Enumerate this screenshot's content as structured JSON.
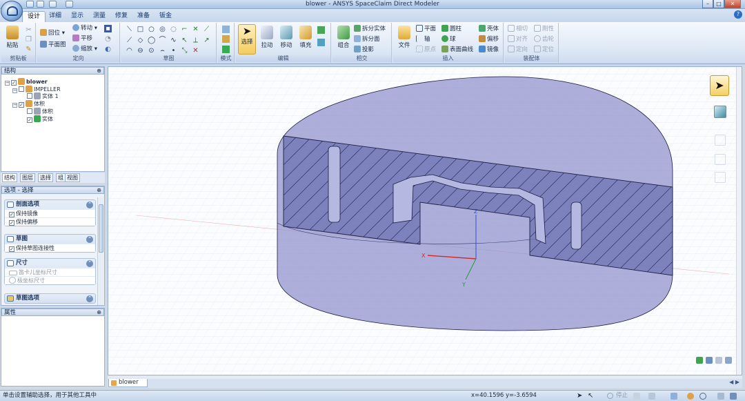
{
  "window": {
    "title": "blower - ANSYS SpaceClaim Direct Modeler",
    "controls": [
      "–",
      "□",
      "✕"
    ]
  },
  "tabs": [
    {
      "label": "设计",
      "active": true
    },
    {
      "label": "详细"
    },
    {
      "label": "显示"
    },
    {
      "label": "测量"
    },
    {
      "label": "修复"
    },
    {
      "label": "准备"
    },
    {
      "label": "钣金"
    }
  ],
  "help_glyph": "?",
  "ribbon": {
    "clipboard": {
      "label": "剪贴板",
      "paste": "粘贴"
    },
    "orient": {
      "label": "定向",
      "home": "回位",
      "plan_view": "平面图",
      "spin": "转动",
      "pan": "平移",
      "zoom": "缩放"
    },
    "sketch": {
      "label": "草图"
    },
    "mode": {
      "label": "模式"
    },
    "edit": {
      "label": "编辑",
      "select": "选择",
      "pull": "拉动",
      "move": "移动",
      "fill": "填充"
    },
    "intersect": {
      "label": "相交",
      "combine": "组合",
      "split_body": "拆分实体",
      "split_face": "拆分面",
      "project": "投影"
    },
    "insert": {
      "label": "插入",
      "file": "文件",
      "plane": "平面",
      "axis": "轴",
      "origin": "原点",
      "cylinder": "圆柱",
      "sphere": "球",
      "surface_curve": "表面曲线",
      "shell": "壳体",
      "offset": "偏移",
      "mirror": "镜像"
    },
    "assembly": {
      "label": "装配体",
      "tangent": "相切",
      "align": "对齐",
      "orient": "定向",
      "rigid": "刚性",
      "gear": "齿轮",
      "anchor": "定位"
    }
  },
  "structure_panel": {
    "title": "结构",
    "pin": "⊕",
    "items": [
      {
        "label": "blower",
        "checked": true,
        "expanded": true,
        "level": 0
      },
      {
        "label": "IMPELLER",
        "checked": false,
        "expanded": true,
        "level": 1
      },
      {
        "label": "实体 1",
        "checked": false,
        "level": 2
      },
      {
        "label": "体积",
        "checked": true,
        "expanded": true,
        "level": 1
      },
      {
        "label": "体积",
        "checked": false,
        "level": 2
      },
      {
        "label": "实体",
        "checked": true,
        "level": 2
      }
    ]
  },
  "panel_tabs": [
    {
      "label": "结构",
      "active": true
    },
    {
      "label": "图层"
    },
    {
      "label": "选择"
    },
    {
      "label": "组"
    },
    {
      "label": "视图"
    }
  ],
  "options_panel": {
    "title": "选项 - 选择",
    "sections": [
      {
        "title": "剖面选项",
        "items": [
          {
            "label": "保持镜像",
            "checked": true
          },
          {
            "label": "保持偏移",
            "checked": true
          }
        ]
      },
      {
        "title": "草图",
        "items": [
          {
            "label": "保持草图连接性",
            "checked": true
          }
        ]
      },
      {
        "title": "尺寸",
        "items": [
          {
            "label": "笛卡儿坐标尺寸",
            "checked": false
          },
          {
            "label": "极坐标尺寸",
            "checked": false
          }
        ]
      },
      {
        "title": "草图选项",
        "items": []
      }
    ]
  },
  "properties_panel": {
    "title": "属性"
  },
  "viewport": {
    "axes": {
      "x": "X",
      "y": "Y",
      "z": "Z"
    },
    "colors": {
      "x": "#d42a2a",
      "y": "#1f9a35",
      "z": "#2a4fd4",
      "body": "#7b80c0"
    }
  },
  "document_tab": {
    "label": "blower"
  },
  "doc_nav": "◀ ▶",
  "status": {
    "text": "单击设置辅助选择，用于其他工具中",
    "coords": "x=40.1596  y=-3.6594",
    "stop_label": "停止"
  }
}
